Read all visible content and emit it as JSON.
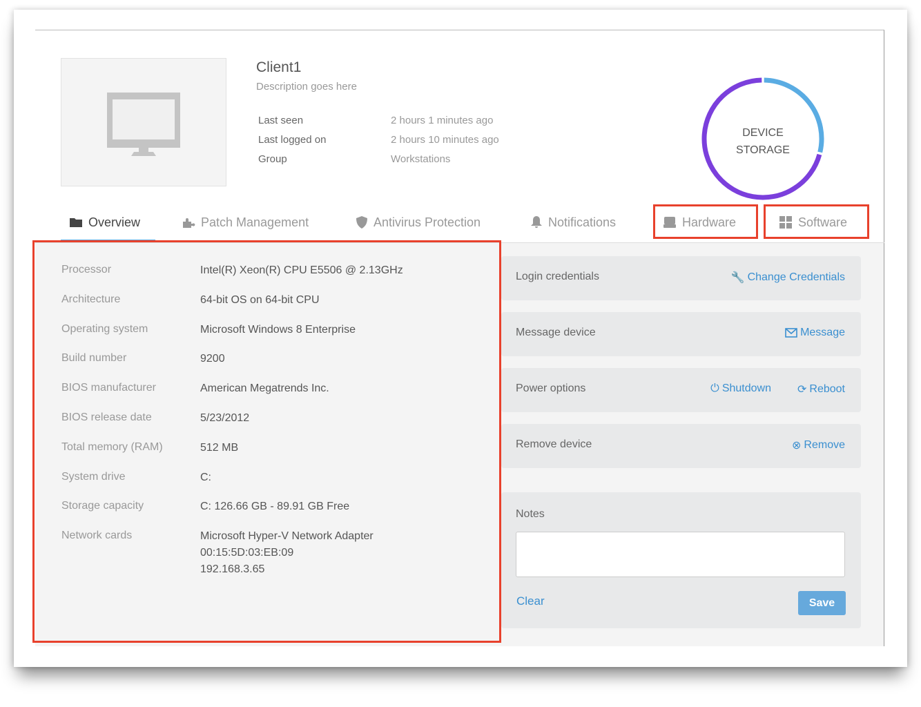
{
  "device": {
    "name": "Client1",
    "description": "Description goes here",
    "meta": [
      {
        "label": "Last seen",
        "value": "2 hours 1 minutes ago"
      },
      {
        "label": "Last logged on",
        "value": "2 hours 10 minutes ago"
      },
      {
        "label": "Group",
        "value": "Workstations"
      }
    ]
  },
  "storage_chart": {
    "line1": "DEVICE",
    "line2": "STORAGE",
    "used_fraction": 0.29,
    "used_color": "#5aace3",
    "free_color": "#7b3fdc"
  },
  "tabs": [
    {
      "label": "Overview",
      "icon": "folder-icon"
    },
    {
      "label": "Patch Management",
      "icon": "puzzle-icon"
    },
    {
      "label": "Antivirus Protection",
      "icon": "shield-icon"
    },
    {
      "label": "Notifications",
      "icon": "bell-icon"
    },
    {
      "label": "Hardware",
      "icon": "hard-drive-icon"
    },
    {
      "label": "Software",
      "icon": "grid-icon"
    }
  ],
  "specs": [
    {
      "label": "Processor",
      "value": "Intel(R) Xeon(R) CPU E5506 @ 2.13GHz"
    },
    {
      "label": "Architecture",
      "value": "64-bit OS on 64-bit CPU"
    },
    {
      "label": "Operating system",
      "value": "Microsoft Windows 8 Enterprise"
    },
    {
      "label": "Build number",
      "value": "9200"
    },
    {
      "label": "BIOS manufacturer",
      "value": "American Megatrends Inc."
    },
    {
      "label": "BIOS release date",
      "value": "5/23/2012"
    },
    {
      "label": "Total memory (RAM)",
      "value": "512 MB"
    },
    {
      "label": "System drive",
      "value": "C:"
    },
    {
      "label": "Storage capacity",
      "value": "C: 126.66 GB - 89.91 GB Free"
    },
    {
      "label": "Network cards",
      "value": "Microsoft Hyper-V Network Adapter",
      "value2": "00:15:5D:03:EB:09",
      "value3": "192.168.3.65"
    }
  ],
  "actions": {
    "login": "Login credentials",
    "change": "Change Credentials",
    "message_title": "Message device",
    "message": "Message",
    "power": "Power options",
    "shutdown": "Shutdown",
    "reboot": "Reboot",
    "remove_title": "Remove device",
    "remove": "Remove"
  },
  "notes": {
    "title": "Notes",
    "value": "",
    "clear": "Clear",
    "save": "Save"
  },
  "highlight_color": "#e8412c",
  "accent": "#3a8fd0"
}
